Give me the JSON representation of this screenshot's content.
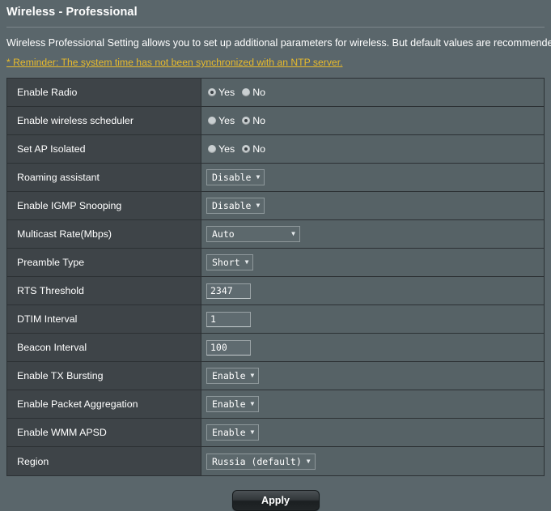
{
  "header": {
    "title": "Wireless - Professional"
  },
  "description": {
    "text": "Wireless Professional Setting allows you to set up additional parameters for wireless. But default values are recommended.",
    "reminder": "* Reminder: The system time has not been synchronized with an NTP server."
  },
  "radio_labels": {
    "yes": "Yes",
    "no": "No"
  },
  "caret_glyph": "▼",
  "rows": [
    {
      "label": "Enable Radio",
      "type": "radio",
      "value": "Yes"
    },
    {
      "label": "Enable wireless scheduler",
      "type": "radio",
      "value": "No"
    },
    {
      "label": "Set AP Isolated",
      "type": "radio",
      "value": "No"
    },
    {
      "label": "Roaming assistant",
      "type": "select",
      "value": "Disable"
    },
    {
      "label": "Enable IGMP Snooping",
      "type": "select",
      "value": "Disable"
    },
    {
      "label": "Multicast Rate(Mbps)",
      "type": "select",
      "value": "Auto",
      "wide": true
    },
    {
      "label": "Preamble Type",
      "type": "select",
      "value": "Short"
    },
    {
      "label": "RTS Threshold",
      "type": "text",
      "value": "2347"
    },
    {
      "label": "DTIM Interval",
      "type": "text",
      "value": "1"
    },
    {
      "label": "Beacon Interval",
      "type": "text",
      "value": "100"
    },
    {
      "label": "Enable TX Bursting",
      "type": "select",
      "value": "Enable"
    },
    {
      "label": "Enable Packet Aggregation",
      "type": "select",
      "value": "Enable"
    },
    {
      "label": "Enable WMM APSD",
      "type": "select",
      "value": "Enable"
    },
    {
      "label": "Region",
      "type": "select",
      "value": "Russia (default)"
    }
  ],
  "footer": {
    "apply_label": "Apply"
  },
  "colors": {
    "page_background": "#5a666b",
    "label_column": "#3e4448",
    "value_column": "#566266",
    "reminder_text": "#e8bb2c",
    "border": "#2c3134"
  }
}
